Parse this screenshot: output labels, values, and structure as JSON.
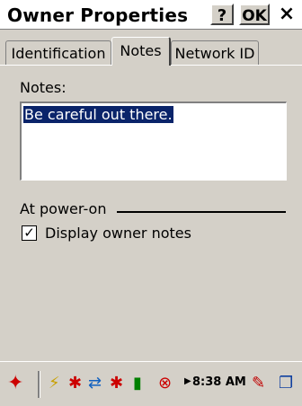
{
  "window": {
    "title": "Owner Properties",
    "help_label": "?",
    "ok_label": "OK",
    "close_label": "×"
  },
  "tabs": [
    {
      "label": "Identification",
      "active": false
    },
    {
      "label": "Notes",
      "active": true
    },
    {
      "label": "Network ID",
      "active": false
    }
  ],
  "notes": {
    "label": "Notes:",
    "value": "Be careful out there."
  },
  "power_on": {
    "group_label": "At power-on",
    "display_notes_label": "Display owner notes",
    "display_notes_checked": true,
    "check_mark": "✓"
  },
  "taskbar": {
    "clock": "8:38 AM",
    "arrow": "▶",
    "start_icon": "✦",
    "icons": [
      "power-plug-icon",
      "network-error-icon",
      "network-icon",
      "network-error-icon",
      "battery-icon",
      "volume-mute-icon",
      "pen-input-icon",
      "windows-cascade-icon"
    ],
    "glyphs": {
      "plug": "⚡",
      "x1": "✱",
      "net": "⇄",
      "x2": "✱",
      "battery": "▮",
      "mute": "⊗",
      "pen": "✎",
      "windows": "❐"
    }
  }
}
